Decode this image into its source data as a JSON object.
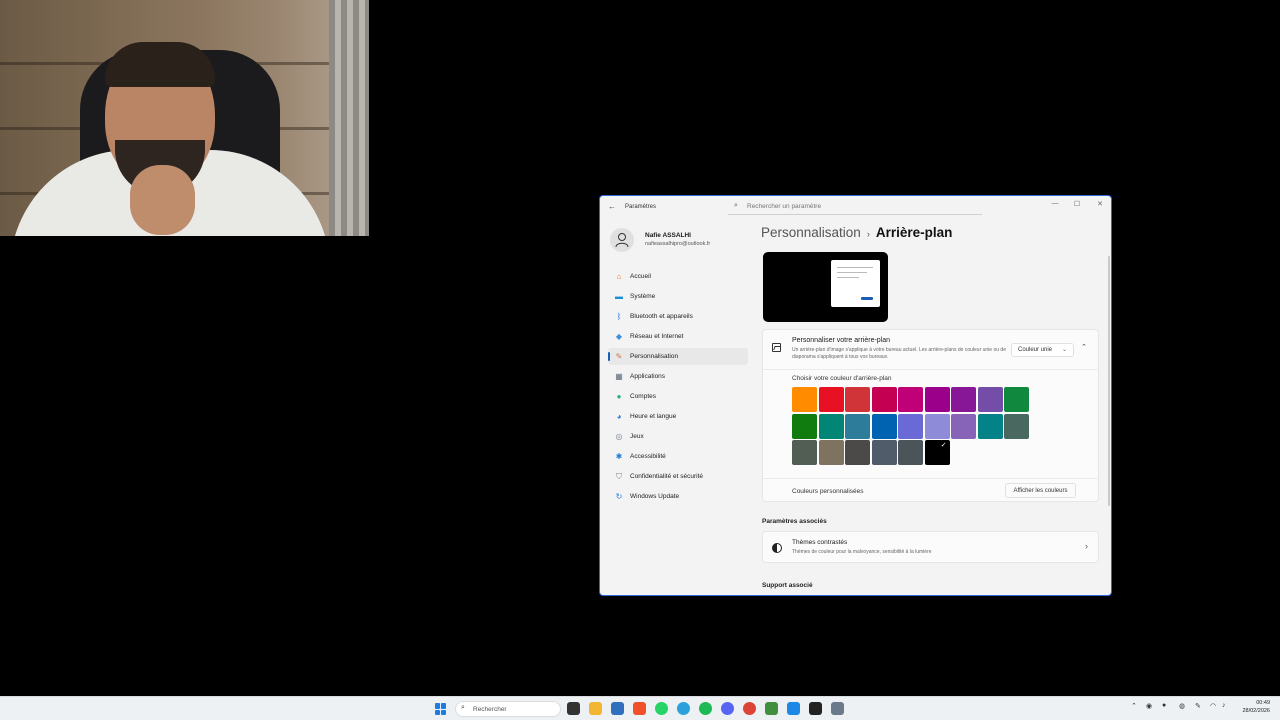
{
  "window": {
    "app_title": "Paramètres",
    "search_placeholder": "Rechercher un paramètre",
    "minimize": "—",
    "maximize": "☐",
    "close": "✕"
  },
  "user": {
    "name": "Nafie ASSALHI",
    "email": "nafieassalhipro@outlook.fr"
  },
  "sidebar": {
    "items": [
      {
        "label": "Accueil",
        "icon": "home-icon",
        "color": "#e8803a",
        "glyph": "⌂"
      },
      {
        "label": "Système",
        "icon": "monitor-icon",
        "color": "#1b8fd4",
        "glyph": "▬"
      },
      {
        "label": "Bluetooth et appareils",
        "icon": "bluetooth-icon",
        "color": "#1b6fd4",
        "glyph": "ᛒ"
      },
      {
        "label": "Réseau et Internet",
        "icon": "wifi-icon",
        "color": "#3a8fe0",
        "glyph": "◆"
      },
      {
        "label": "Personnalisation",
        "icon": "brush-icon",
        "color": "#d0743a",
        "glyph": "✎"
      },
      {
        "label": "Applications",
        "icon": "apps-icon",
        "color": "#5b6b7b",
        "glyph": "▦"
      },
      {
        "label": "Comptes",
        "icon": "person-icon",
        "color": "#2fae78",
        "glyph": "●"
      },
      {
        "label": "Heure et langue",
        "icon": "globe-clock-icon",
        "color": "#2a7fd0",
        "glyph": "◕"
      },
      {
        "label": "Jeux",
        "icon": "gamepad-icon",
        "color": "#7b8793",
        "glyph": "◎"
      },
      {
        "label": "Accessibilité",
        "icon": "accessibility-icon",
        "color": "#1f7bd8",
        "glyph": "✱"
      },
      {
        "label": "Confidentialité et sécurité",
        "icon": "shield-icon",
        "color": "#7b8793",
        "glyph": "⛉"
      },
      {
        "label": "Windows Update",
        "icon": "update-icon",
        "color": "#1f7bd8",
        "glyph": "↻"
      }
    ],
    "active_index": 4
  },
  "breadcrumb": {
    "parent": "Personnalisation",
    "separator": "›",
    "current": "Arrière-plan"
  },
  "background": {
    "title": "Personnaliser votre arrière-plan",
    "description": "Un arrière-plan d'image s'applique à votre bureau actuel. Les arrière-plans de couleur unie ou de diaporama s'appliquent à tous vos bureaux.",
    "type_value": "Couleur unie",
    "collapse_glyph": "⌃",
    "color_heading": "Choisir votre couleur d'arrière-plan",
    "colors": [
      [
        "#ff8c00",
        "#e81123",
        "#d13438",
        "#c30052",
        "#bf0077",
        "#9a0089",
        "#881798",
        "#744da9",
        "#10893e"
      ],
      [
        "#107c10",
        "#018574",
        "#2d7d9a",
        "#0063b1",
        "#6b69d6",
        "#8e8cd8",
        "#8764b8",
        "#038387",
        "#486860"
      ],
      [
        "#525e54",
        "#7e735f",
        "#4c4a48",
        "#515c6b",
        "#4a5459",
        "#000000"
      ]
    ],
    "selected_color": "#000000",
    "custom_label": "Couleurs personnalisées",
    "show_colors_button": "Afficher les couleurs"
  },
  "related": {
    "heading": "Paramètres associés",
    "contrast_title": "Thèmes contrastés",
    "contrast_desc": "Thèmes de couleur pour la malvoyance, sensibilité à la lumière",
    "support_heading": "Support associé"
  },
  "taskbar": {
    "search_label": "Rechercher",
    "apps": [
      {
        "name": "task-view-icon",
        "color": "#333333"
      },
      {
        "name": "file-explorer-icon",
        "color": "#f2b632"
      },
      {
        "name": "store-icon",
        "color": "#2f6fbd"
      },
      {
        "name": "brave-icon",
        "color": "#f0512a"
      },
      {
        "name": "whatsapp-icon",
        "color": "#25d366"
      },
      {
        "name": "telegram-icon",
        "color": "#2aa1da"
      },
      {
        "name": "spotify-icon",
        "color": "#1db954"
      },
      {
        "name": "discord-icon",
        "color": "#5865f2"
      },
      {
        "name": "chrome-icon",
        "color": "#db4437"
      },
      {
        "name": "minecraft-icon",
        "color": "#3f8f3f"
      },
      {
        "name": "vscode-icon",
        "color": "#1e88e5"
      },
      {
        "name": "notion-icon",
        "color": "#222222"
      },
      {
        "name": "settings-icon",
        "color": "#6b7a8a"
      }
    ],
    "time": "00:49",
    "date": "28/02/2026"
  }
}
